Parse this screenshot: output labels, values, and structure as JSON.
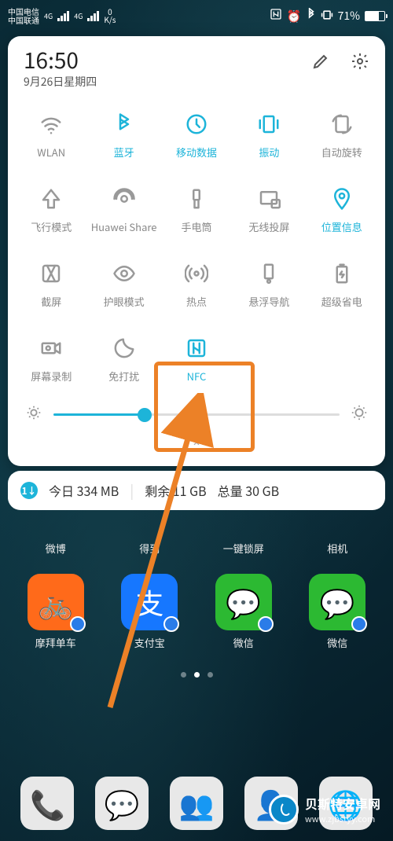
{
  "status": {
    "carrier1": "中国电信",
    "carrier2": "中国联通",
    "gen1": "4G",
    "gen2": "4G",
    "speed_v": "0",
    "speed_u": "K/s",
    "battery_pct": "71%"
  },
  "panel": {
    "time": "16:50",
    "date": "9月26日星期四"
  },
  "tiles": [
    {
      "label": "WLAN",
      "icon": "wifi",
      "on": false
    },
    {
      "label": "蓝牙",
      "icon": "bluetooth",
      "on": true
    },
    {
      "label": "移动数据",
      "icon": "data",
      "on": true
    },
    {
      "label": "振动",
      "icon": "vibrate",
      "on": true
    },
    {
      "label": "自动旋转",
      "icon": "rotate",
      "on": false
    },
    {
      "label": "飞行模式",
      "icon": "plane",
      "on": false
    },
    {
      "label": "Huawei Share",
      "icon": "share",
      "on": false
    },
    {
      "label": "手电筒",
      "icon": "torch",
      "on": false
    },
    {
      "label": "无线投屏",
      "icon": "cast",
      "on": false
    },
    {
      "label": "位置信息",
      "icon": "location",
      "on": true
    },
    {
      "label": "截屏",
      "icon": "screenshot",
      "on": false
    },
    {
      "label": "护眼模式",
      "icon": "eye",
      "on": false
    },
    {
      "label": "热点",
      "icon": "hotspot",
      "on": false
    },
    {
      "label": "悬浮导航",
      "icon": "float",
      "on": false
    },
    {
      "label": "超级省电",
      "icon": "battery",
      "on": false
    },
    {
      "label": "屏幕录制",
      "icon": "record",
      "on": false
    },
    {
      "label": "免打扰",
      "icon": "dnd",
      "on": false
    },
    {
      "label": "NFC",
      "icon": "nfc",
      "on": true
    }
  ],
  "data_bar": {
    "icon_text": "1↓",
    "today": "今日 334 MB",
    "remain": "剩余 11 GB",
    "total": "总量 30 GB"
  },
  "apps_row_partial": [
    "微博",
    "得到",
    "一键锁屏",
    "相机"
  ],
  "apps_row2": [
    {
      "label": "摩拜单车",
      "color": "#ff6a1a",
      "glyph": "🚲"
    },
    {
      "label": "支付宝",
      "color": "#1677ff",
      "glyph": "支"
    },
    {
      "label": "微信",
      "color": "#2cb932",
      "glyph": "💬"
    },
    {
      "label": "微信",
      "color": "#2cb932",
      "glyph": "💬"
    }
  ],
  "dock": [
    {
      "color": "#e8e8e8",
      "glyph": "📞"
    },
    {
      "color": "#e8e8e8",
      "glyph": "💬"
    },
    {
      "color": "#e8e8e8",
      "glyph": "👥"
    },
    {
      "color": "#e8e8e8",
      "glyph": "👤"
    },
    {
      "color": "#e8e8e8",
      "glyph": "🌐"
    }
  ],
  "footer": {
    "cn": "贝斯特安卓网",
    "url": "www.zjbstyy.com"
  }
}
